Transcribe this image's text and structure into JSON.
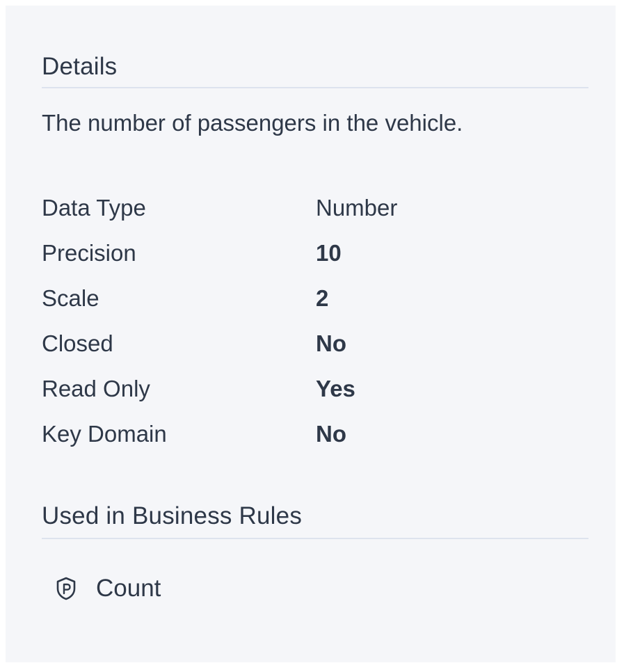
{
  "details": {
    "title": "Details",
    "description": "The number of passengers in the vehicle."
  },
  "properties": [
    {
      "label": "Data Type",
      "value": "Number",
      "bold": false
    },
    {
      "label": "Precision",
      "value": "10",
      "bold": true
    },
    {
      "label": "Scale",
      "value": "2",
      "bold": true
    },
    {
      "label": "Closed",
      "value": "No",
      "bold": true
    },
    {
      "label": "Read Only",
      "value": "Yes",
      "bold": true
    },
    {
      "label": "Key Domain",
      "value": "No",
      "bold": true
    }
  ],
  "business_rules": {
    "title": "Used in Business Rules",
    "items": [
      {
        "label": "Count",
        "icon": "shield-rule-icon"
      }
    ]
  }
}
